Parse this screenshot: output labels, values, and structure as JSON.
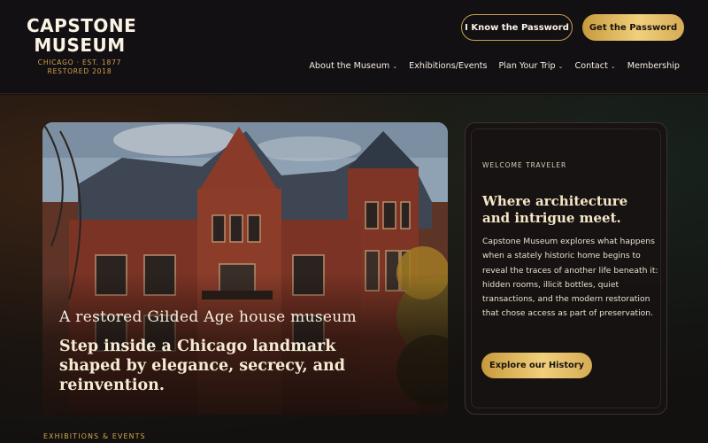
{
  "logo": {
    "title_line1": "CAPSTONE",
    "title_line2": "MUSEUM",
    "sub_line1": "CHICAGO · EST. 1877",
    "sub_line2": "RESTORED 2018"
  },
  "header": {
    "know_password_label": "I Know the Password",
    "get_password_label": "Get the Password"
  },
  "nav": {
    "items": [
      {
        "label": "About the Museum",
        "dropdown": true
      },
      {
        "label": "Exhibitions/Events",
        "dropdown": false
      },
      {
        "label": "Plan Your Trip",
        "dropdown": true
      },
      {
        "label": "Contact",
        "dropdown": true
      },
      {
        "label": "Membership",
        "dropdown": false
      }
    ],
    "chevron": "⌄"
  },
  "hero": {
    "kicker": "A restored Gilded Age house museum",
    "headline": "Step inside a Chicago landmark shaped by elegance, secrecy, and reinvention."
  },
  "welcome": {
    "eyebrow": "WELCOME TRAVELER",
    "title": "Where architecture and intrigue meet.",
    "body": "Capstone Museum explores what happens when a stately historic home begins to reveal the traces of another life beneath it: hidden rooms, illicit bottles, quiet transactions, and the modern restoration that chose access as part of preservation.",
    "cta_label": "Explore our History"
  },
  "section": {
    "label": "EXHIBITIONS & EVENTS"
  },
  "colors": {
    "accent_gold": "#d6a84e",
    "background": "#131014",
    "text_light": "#f3e9d6"
  }
}
